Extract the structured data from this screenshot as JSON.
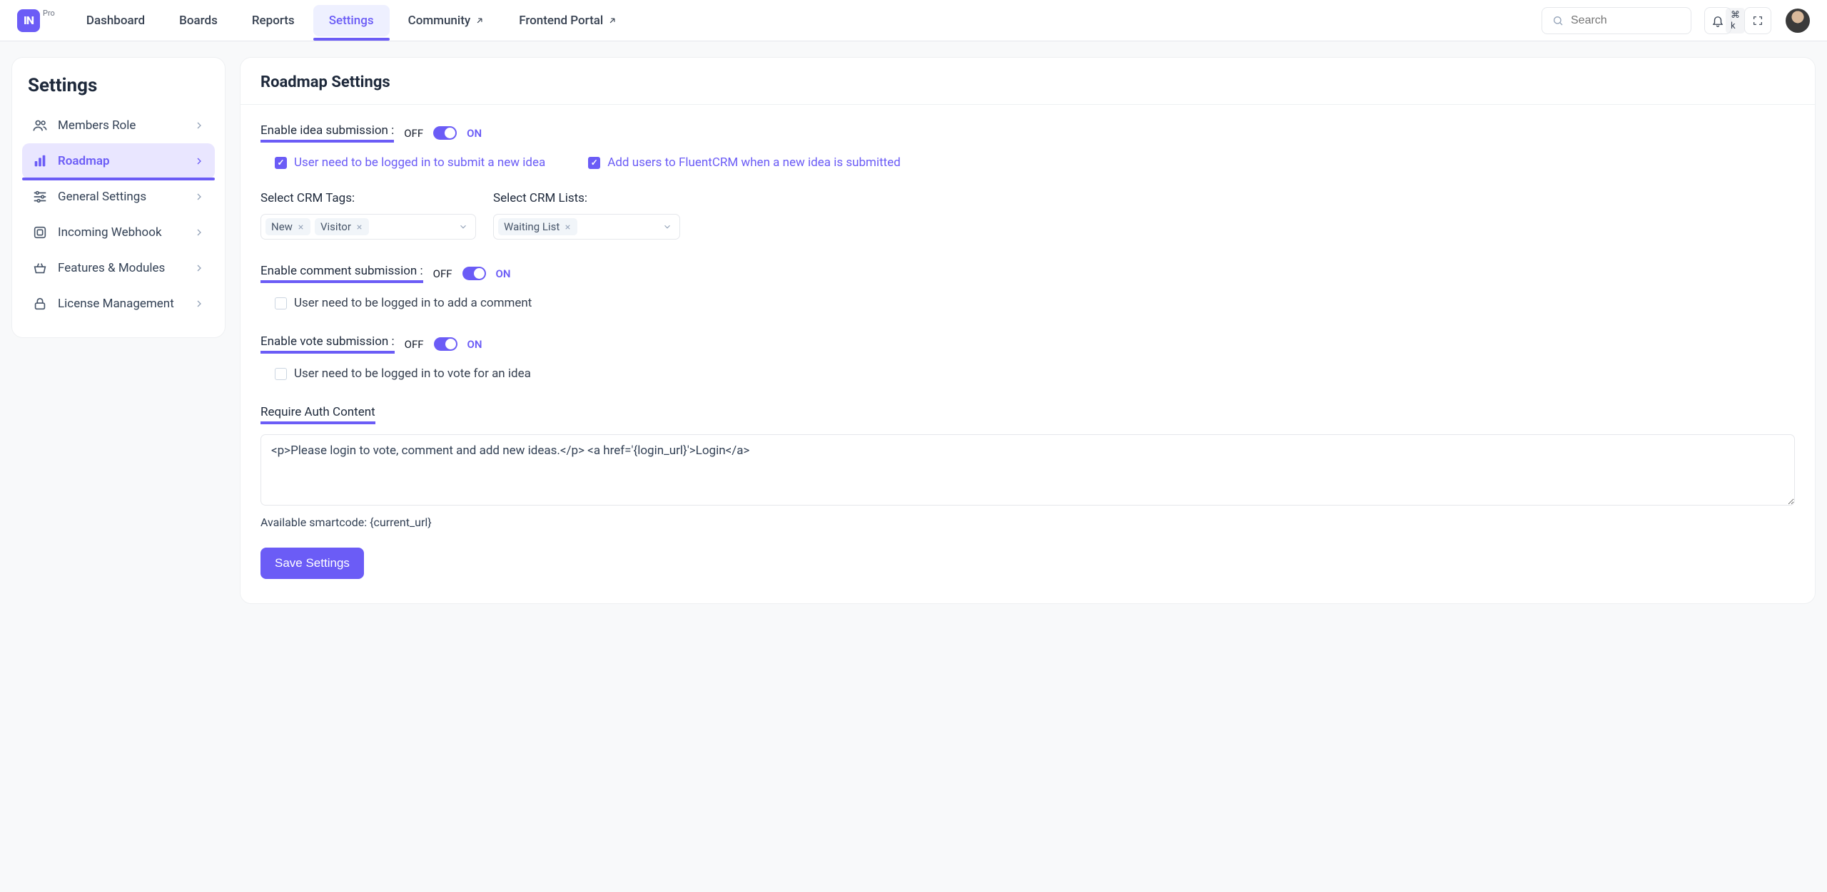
{
  "header": {
    "logo_text": "IN",
    "pro_label": "Pro",
    "nav": [
      {
        "label": "Dashboard",
        "external": false
      },
      {
        "label": "Boards",
        "external": false
      },
      {
        "label": "Reports",
        "external": false
      },
      {
        "label": "Settings",
        "external": false,
        "active": true
      },
      {
        "label": "Community",
        "external": true
      },
      {
        "label": "Frontend Portal",
        "external": true
      }
    ],
    "search_placeholder": "Search",
    "search_kbd": "⌘ k"
  },
  "sidebar": {
    "title": "Settings",
    "items": [
      {
        "label": "Members Role"
      },
      {
        "label": "Roadmap",
        "active": true
      },
      {
        "label": "General Settings"
      },
      {
        "label": "Incoming Webhook"
      },
      {
        "label": "Features & Modules"
      },
      {
        "label": "License Management"
      }
    ]
  },
  "main": {
    "title": "Roadmap Settings",
    "idea": {
      "label": "Enable idea submission :",
      "off": "OFF",
      "on": "ON",
      "check1": "User need to be logged in to submit a new idea",
      "check2": "Add users to FluentCRM when a new idea is submitted"
    },
    "crm_tags": {
      "label": "Select CRM Tags:",
      "values": [
        "New",
        "Visitor"
      ]
    },
    "crm_lists": {
      "label": "Select CRM Lists:",
      "values": [
        "Waiting List"
      ]
    },
    "comment": {
      "label": "Enable comment submission :",
      "off": "OFF",
      "on": "ON",
      "check1": "User need to be logged in to add a comment"
    },
    "vote": {
      "label": "Enable vote submission :",
      "off": "OFF",
      "on": "ON",
      "check1": "User need to be logged in to vote for an idea"
    },
    "auth": {
      "label": "Require Auth Content",
      "value": "<p>Please login to vote, comment and add new ideas.</p> <a href='{login_url}'>Login</a>",
      "hint": "Available smartcode: {current_url}"
    },
    "save_label": "Save Settings"
  }
}
